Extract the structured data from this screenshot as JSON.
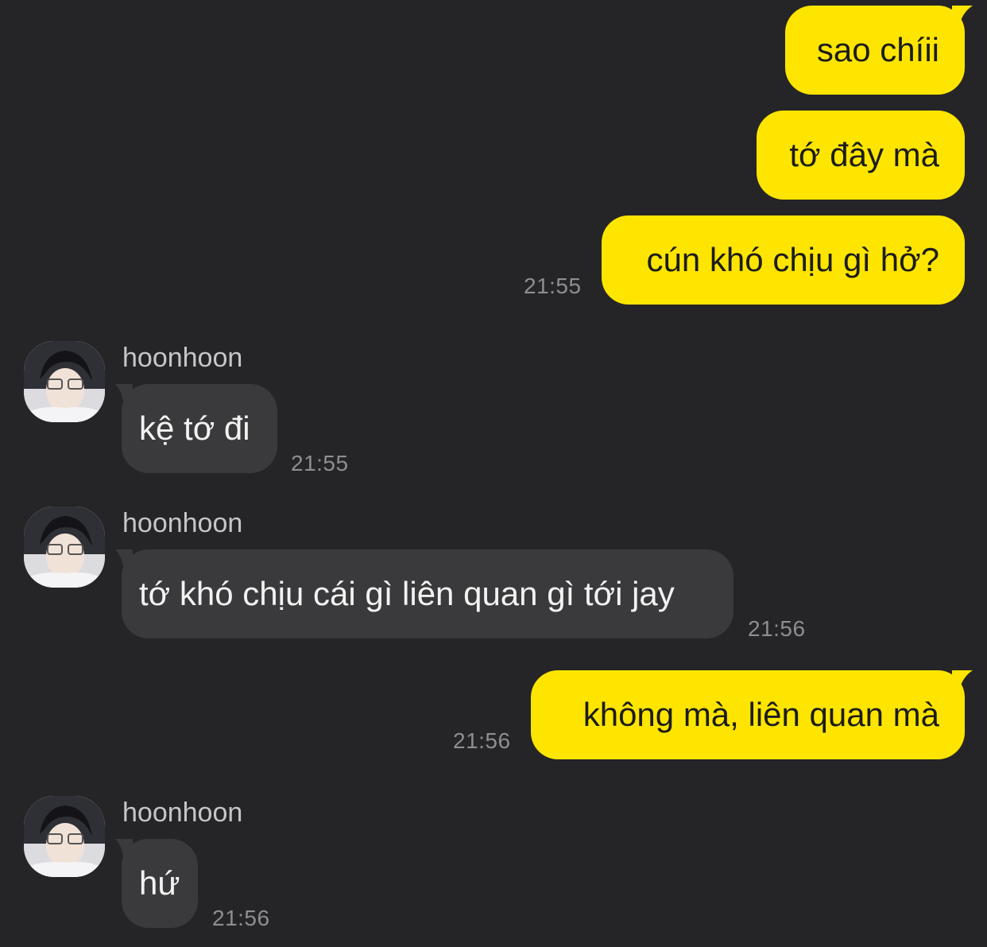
{
  "colors": {
    "background": "#252527",
    "outgoing_bubble": "#fee500",
    "incoming_bubble": "#3a3a3c",
    "timestamp": "#8e8e92",
    "sender_name": "#c6c6c8"
  },
  "messages": [
    {
      "direction": "outgoing",
      "text": "sao chíii",
      "time": ""
    },
    {
      "direction": "outgoing",
      "text": "tớ đây mà",
      "time": ""
    },
    {
      "direction": "outgoing",
      "text": "cún khó chịu gì hở?",
      "time": "21:55"
    },
    {
      "direction": "incoming",
      "sender": "hoonhoon",
      "avatar_icon": "profile-photo",
      "text": "kệ tớ đi",
      "time": "21:55"
    },
    {
      "direction": "incoming",
      "sender": "hoonhoon",
      "avatar_icon": "profile-photo",
      "text": "tớ khó chịu cái gì liên quan gì tới jay",
      "time": "21:56"
    },
    {
      "direction": "outgoing",
      "text": "không mà, liên quan mà",
      "time": "21:56"
    },
    {
      "direction": "incoming",
      "sender": "hoonhoon",
      "avatar_icon": "profile-photo",
      "text": "hứ",
      "time": "21:56"
    }
  ]
}
